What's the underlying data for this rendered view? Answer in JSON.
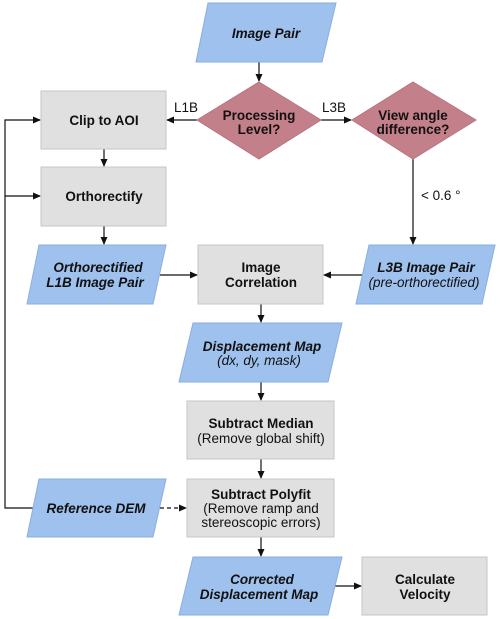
{
  "colors": {
    "data_node": "#9fc1ee",
    "process_node": "#e0e0e0",
    "decision_node": "#c4808a"
  },
  "nodes": {
    "image_pair": "Image Pair",
    "processing_level": [
      "Processing",
      "Level?"
    ],
    "view_angle": [
      "View angle",
      "difference?"
    ],
    "clip_to_aoi": "Clip to AOI",
    "orthorectify": "Orthorectify",
    "ortho_l1b": [
      "Orthorectified",
      "L1B Image Pair"
    ],
    "image_correlation": [
      "Image",
      "Correlation"
    ],
    "l3b_pair": {
      "title": "L3B Image Pair",
      "subtitle": "(pre-orthorectified)"
    },
    "displacement_map": {
      "title": "Displacement Map",
      "subtitle": "(dx, dy, mask)"
    },
    "subtract_median": {
      "title": "Subtract Median",
      "subtitle": "(Remove global shift)"
    },
    "subtract_polyfit": {
      "title": "Subtract Polyfit",
      "subtitle": [
        "(Remove ramp and",
        "stereoscopic errors)"
      ]
    },
    "reference_dem": "Reference DEM",
    "corrected_map": [
      "Corrected",
      "Displacement Map"
    ],
    "calculate_velocity": [
      "Calculate",
      "Velocity"
    ]
  },
  "edge_labels": {
    "l1b": "L1B",
    "l3b": "L3B",
    "angle_threshold": "< 0.6 °"
  }
}
